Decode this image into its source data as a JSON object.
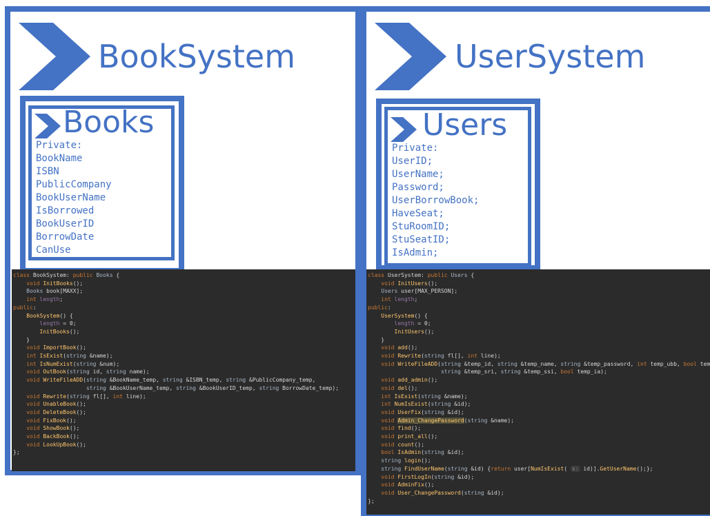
{
  "book_system": {
    "title": "BookSystem",
    "class_name": "Books",
    "fields": [
      "Private:",
      "BookName",
      "ISBN",
      "PublicCompany",
      "BookUserName",
      "IsBorrowed",
      "BookUserID",
      "BorrowDate",
      "CanUse"
    ],
    "code": [
      "class BookSystem: public Books {",
      "    void InitBooks();",
      "    Books book[MAXX];",
      "    int length;",
      "public:",
      "    BookSystem() {",
      "        length = 0;",
      "        InitBooks();",
      "    }",
      "    void ImportBook();",
      "    int IsExist(string &name);",
      "    int IsNumExist(string &num);",
      "    void OutBook(string id, string name);",
      "    void WriteFileADD(string &BookName_temp, string &ISBN_temp, string &PublicCompany_temp,",
      "                      string &BookUserName_temp, string &BookUserID_temp, string BorrowDate_temp);",
      "    void Rewrite(string fl[], int line);",
      "    void UnableBook();",
      "    void DeleteBook();",
      "    void FixBook();",
      "    void ShowBook();",
      "    void BackBook();",
      "    void LookUpBook();",
      "};"
    ]
  },
  "user_system": {
    "title": "UserSystem",
    "class_name": "Users",
    "fields": [
      "Private:",
      "UserID;",
      "UserName;",
      "Password;",
      "UserBorrowBook;",
      "HaveSeat;",
      "StuRoomID;",
      "StuSeatID;",
      "IsAdmin;"
    ],
    "code": [
      "class UserSystem: public Users {",
      "    void InitUsers();",
      "    Users user[MAX_PERSON];",
      "    int length;",
      "public:",
      "    UserSystem() {",
      "        length = 0;",
      "        InitUsers();",
      "    }",
      "    void add();",
      "    void Rewrite(string fl[], int line);",
      "    void WriteFileADD(string &temp_id, string &temp_name, string &temp_password, int temp_ubb, bool temp_hs,",
      "                      string &temp_sri, string &temp_ssi, bool temp_ia);",
      "    void add_admin();",
      "    void del();",
      "    int IsExist(string &name);",
      "    int NumIsExist(string &id);",
      "    void UserFix(string &id);",
      "    void Admin_ChangePassword(string &name);",
      "    void find();",
      "    void print_all();",
      "    void count();",
      "    bool IsAdmin(string &id);",
      "    string login();",
      "    string FindUserName(string &id) {return user[NumIsExist( id)].GetUserName();};",
      "    void FirstLogIn(string &id);",
      "    void AdminFix();",
      "    void User_ChangePassword(string &id);",
      "};"
    ],
    "inlay_hint": "s:"
  },
  "colors": {
    "accent": "#4472c4",
    "code_background": "#2b2b2b",
    "keyword": "#cc7832",
    "function": "#ffc66d"
  },
  "icons": [
    "chevron-arrow-icon"
  ]
}
